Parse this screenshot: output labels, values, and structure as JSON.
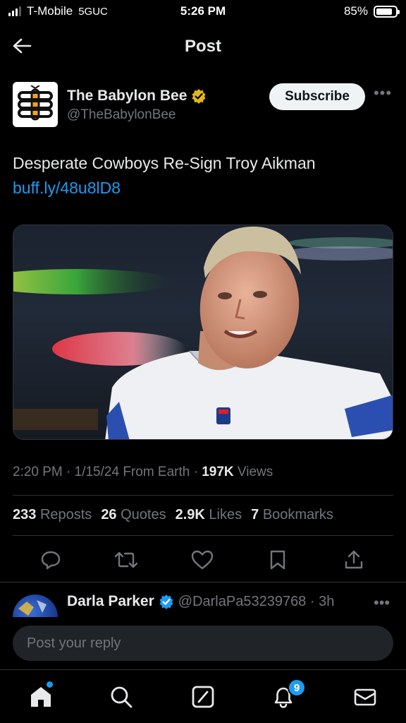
{
  "status_bar": {
    "carrier": "T-Mobile",
    "network": "5GUC",
    "time": "5:26 PM",
    "battery": "85%",
    "battery_level": 0.85
  },
  "header": {
    "title": "Post",
    "back_icon": "arrow-left-icon"
  },
  "post": {
    "author_name": "The Babylon Bee",
    "author_handle": "@TheBabylonBee",
    "verified_badge": "gold-check-badge-icon",
    "subscribe_label": "Subscribe",
    "more_label": "•••",
    "text": "Desperate Cowboys Re-Sign Troy Aikman",
    "link": "buff.ly/48u8lD8",
    "media_icon": "football-player-photo",
    "meta_prefix": "2:20 PM · 1/15/24 From Earth · ",
    "views_count": "197K",
    "views_label": " Views"
  },
  "stats": {
    "reposts_count": "233",
    "reposts_label": "Reposts",
    "quotes_count": "26",
    "quotes_label": "Quotes",
    "likes_count": "2.9K",
    "likes_label": "Likes",
    "bookmarks_count": "7",
    "bookmarks_label": "Bookmarks"
  },
  "actions": [
    "reply-icon",
    "repost-icon",
    "like-icon",
    "bookmark-icon",
    "share-icon"
  ],
  "reply_preview": {
    "name": "Darla Parker",
    "handle": "@DarlaPa53239768 · 3h",
    "more_label": "•••"
  },
  "reply_box": {
    "placeholder": "Post your reply"
  },
  "tab_bar": {
    "tabs": [
      "home-icon",
      "search-icon",
      "grok-icon",
      "notifications-icon",
      "messages-icon"
    ],
    "notifications_badge": "9"
  },
  "colors": {
    "accent": "#1d9bf0",
    "verified_gold": "#e2b719",
    "background": "#000000",
    "muted_text": "#71767b"
  }
}
